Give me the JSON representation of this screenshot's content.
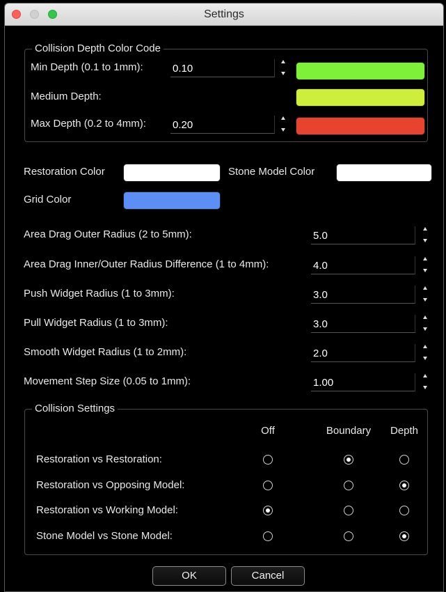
{
  "window": {
    "title": "Settings"
  },
  "collision_depth": {
    "legend": "Collision Depth Color Code",
    "min_label": "Min Depth (0.1 to 1mm):",
    "min_value": "0.10",
    "medium_label": "Medium Depth:",
    "max_label": "Max Depth (0.2 to 4mm):",
    "max_value": "0.20",
    "colors": {
      "min": "#7ff03a",
      "medium": "#cdef3c",
      "max": "#e8432f"
    }
  },
  "colors": {
    "restoration_label": "Restoration Color",
    "stone_label": "Stone Model Color",
    "grid_label": "Grid Color",
    "restoration_color": "#ffffff",
    "stone_color": "#ffffff",
    "grid_color": "#5b8ff5"
  },
  "params": [
    {
      "label": "Area Drag Outer Radius (2 to 5mm):",
      "value": "5.0"
    },
    {
      "label": "Area Drag Inner/Outer Radius Difference (1 to 4mm):",
      "value": "4.0"
    },
    {
      "label": "Push Widget Radius (1 to 3mm):",
      "value": "3.0"
    },
    {
      "label": "Pull Widget Radius (1 to 3mm):",
      "value": "3.0"
    },
    {
      "label": "Smooth Widget Radius (1 to 2mm):",
      "value": "2.0"
    },
    {
      "label": "Movement Step Size (0.05 to 1mm):",
      "value": "1.00"
    }
  ],
  "collision_settings": {
    "legend": "Collision Settings",
    "columns": [
      "Off",
      "Boundary",
      "Depth"
    ],
    "rows": [
      {
        "label": "Restoration vs Restoration:",
        "selected": "Boundary"
      },
      {
        "label": "Restoration vs Opposing Model:",
        "selected": "Depth"
      },
      {
        "label": "Restoration vs Working Model:",
        "selected": "Off"
      },
      {
        "label": "Stone Model vs Stone Model:",
        "selected": "Depth"
      }
    ]
  },
  "buttons": {
    "ok": "OK",
    "cancel": "Cancel"
  }
}
